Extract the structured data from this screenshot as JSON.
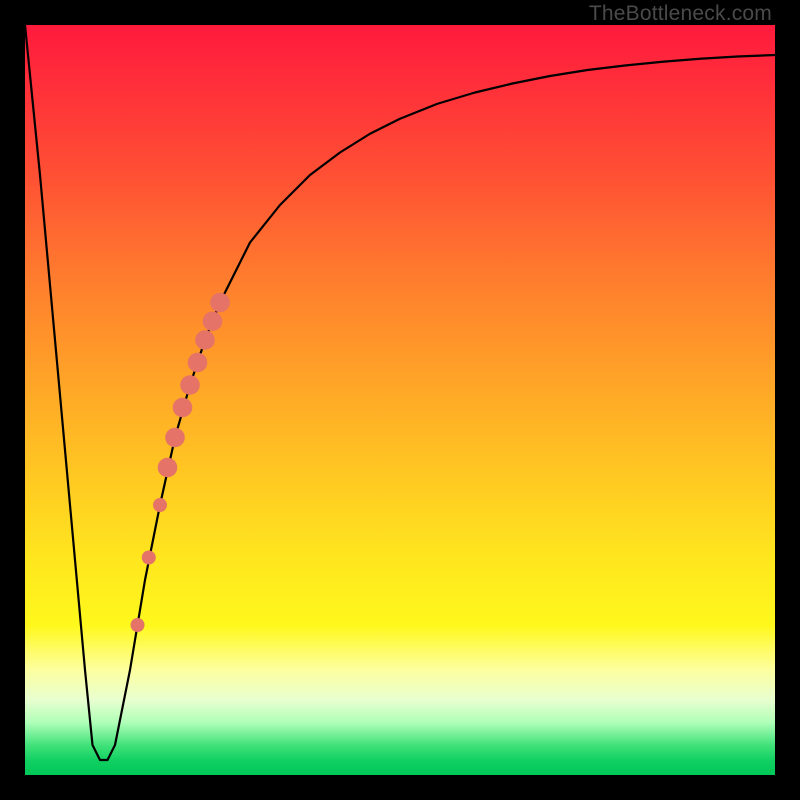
{
  "watermark": "TheBottleneck.com",
  "colors": {
    "frame": "#000000",
    "curve": "#000000",
    "markers": "#e57368",
    "gradient_top": "#ff1a3c",
    "gradient_bottom": "#00c858"
  },
  "chart_data": {
    "type": "line",
    "title": "",
    "xlabel": "",
    "ylabel": "",
    "xlim": [
      0,
      100
    ],
    "ylim": [
      0,
      100
    ],
    "grid": false,
    "series": [
      {
        "name": "bottleneck-curve",
        "x": [
          0,
          2,
          4,
          6,
          8,
          9,
          10,
          11,
          12,
          14,
          16,
          18,
          20,
          22,
          24,
          26,
          28,
          30,
          34,
          38,
          42,
          46,
          50,
          55,
          60,
          65,
          70,
          75,
          80,
          85,
          90,
          95,
          100
        ],
        "y": [
          100,
          80,
          58,
          36,
          14,
          4,
          2,
          2,
          4,
          14,
          26,
          36,
          45,
          52,
          58,
          63,
          67,
          71,
          76,
          80,
          83,
          85.5,
          87.5,
          89.5,
          91,
          92.2,
          93.2,
          94,
          94.6,
          95.1,
          95.5,
          95.8,
          96
        ]
      }
    ],
    "markers": {
      "name": "highlight-points",
      "style": "circle",
      "color": "#e57368",
      "points": [
        {
          "x": 15.0,
          "y": 20,
          "r": 1.0
        },
        {
          "x": 16.5,
          "y": 29,
          "r": 1.0
        },
        {
          "x": 18.0,
          "y": 36,
          "r": 1.0
        },
        {
          "x": 19.0,
          "y": 41,
          "r": 1.4
        },
        {
          "x": 20.0,
          "y": 45,
          "r": 1.4
        },
        {
          "x": 21.0,
          "y": 49,
          "r": 1.4
        },
        {
          "x": 22.0,
          "y": 52,
          "r": 1.4
        },
        {
          "x": 23.0,
          "y": 55,
          "r": 1.4
        },
        {
          "x": 24.0,
          "y": 58,
          "r": 1.4
        },
        {
          "x": 25.0,
          "y": 60.5,
          "r": 1.4
        },
        {
          "x": 26.0,
          "y": 63,
          "r": 1.4
        }
      ]
    }
  }
}
